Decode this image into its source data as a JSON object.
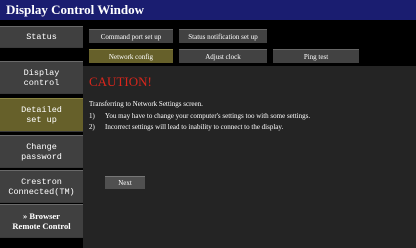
{
  "window": {
    "title": "Display Control Window"
  },
  "sidebar": {
    "items": [
      {
        "label": "Status"
      },
      {
        "label": "Display\ncontrol"
      },
      {
        "label": "Detailed\nset up"
      },
      {
        "label": "Change\npassword"
      },
      {
        "label": "Crestron\nConnected(TM)"
      },
      {
        "label": "» Browser\nRemote Control"
      }
    ],
    "active_index": 2
  },
  "tabs": {
    "row1": [
      {
        "label": "Command port set up"
      },
      {
        "label": "Status notification set up"
      }
    ],
    "row2": [
      {
        "label": "Network config"
      },
      {
        "label": "Adjust clock"
      },
      {
        "label": "Ping test"
      }
    ],
    "active": "Network config"
  },
  "content": {
    "caution": "CAUTION!",
    "intro": "Transferring to Network Settings screen.",
    "notes": [
      {
        "num": "1)",
        "text": "You may have to change your computer's settings too with some settings."
      },
      {
        "num": "2)",
        "text": "Incorrect settings will lead to inability to connect to the display."
      }
    ],
    "next_label": "Next"
  },
  "colors": {
    "title_bar": "#1a1d70",
    "caution_text": "#d9261c",
    "active_item": "#66602a",
    "button": "#424242",
    "panel": "#242424"
  }
}
